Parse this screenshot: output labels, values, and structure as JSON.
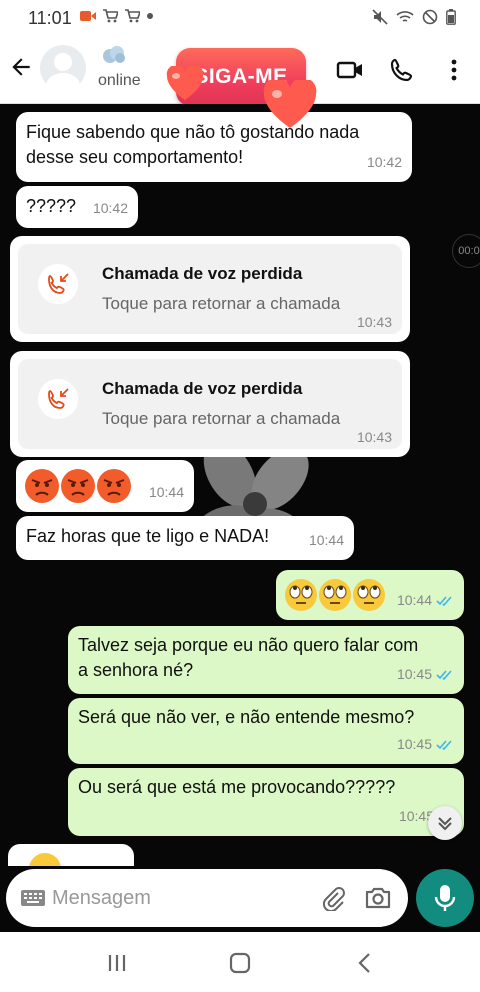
{
  "status_bar": {
    "time": "11:01",
    "left_icons": [
      "video-record-icon",
      "cart-icon",
      "cart-icon",
      "dot-icon"
    ],
    "right_icons": [
      "mute-icon",
      "wifi-icon",
      "dnd-icon",
      "battery-icon"
    ]
  },
  "header": {
    "status": "online",
    "promo_label": "SIGA-ME"
  },
  "timer_label": "00:0",
  "messages": [
    {
      "type": "in",
      "text_lines": [
        "Fique sabendo que não tô gostando nada",
        "desse seu comportamento!"
      ],
      "time": "10:42"
    },
    {
      "type": "in",
      "text": "?????",
      "time": "10:42"
    },
    {
      "type": "call",
      "title": "Chamada de voz perdida",
      "subtitle": "Toque para retornar a chamada",
      "time": "10:43"
    },
    {
      "type": "call",
      "title": "Chamada de voz perdida",
      "subtitle": "Toque para retornar a chamada",
      "time": "10:43"
    },
    {
      "type": "in",
      "text": "",
      "emoji": "angry x3",
      "time": "10:44"
    },
    {
      "type": "in",
      "text": "Faz horas que te ligo e NADA!",
      "time": "10:44"
    },
    {
      "type": "out",
      "text": "",
      "emoji": "eye-roll x3",
      "time": "10:44",
      "read": true
    },
    {
      "type": "out",
      "text_lines": [
        "Talvez seja porque eu não quero falar com",
        "a senhora né?"
      ],
      "time": "10:45",
      "read": true
    },
    {
      "type": "out",
      "text": "Será que não ver, e não entende mesmo?",
      "time": "10:45",
      "read": true
    },
    {
      "type": "out",
      "text": "Ou será que está me provocando?????",
      "time": "10:45",
      "read": false
    }
  ],
  "input": {
    "placeholder": "Mensagem"
  },
  "colors": {
    "incoming": "#ffffff",
    "outgoing": "#dbf8c6",
    "accent": "#128c7e",
    "missed_call": "#e64a19",
    "read_ticks": "#34b7f1"
  }
}
